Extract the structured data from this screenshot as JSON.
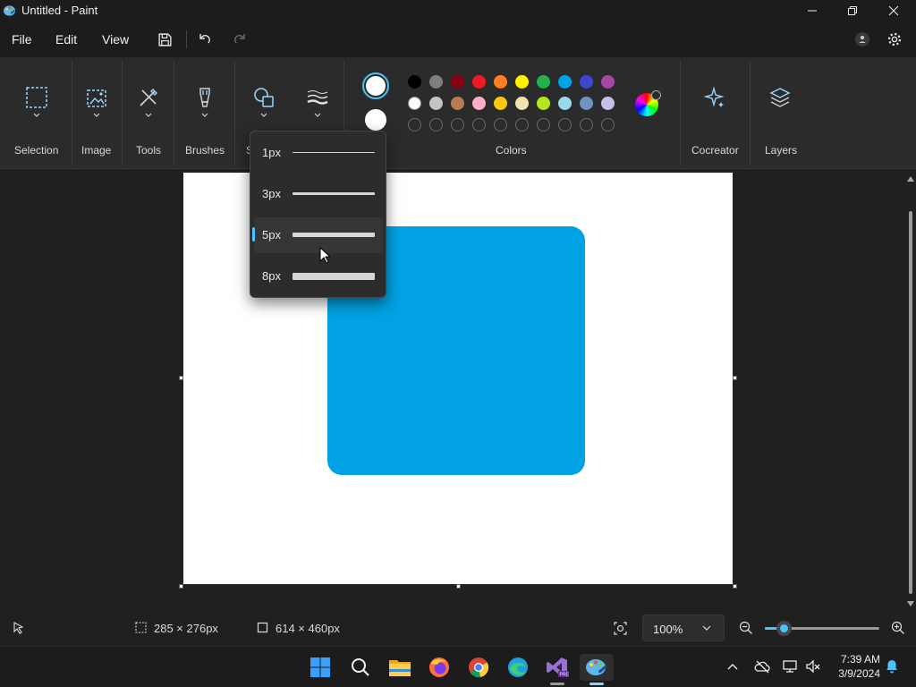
{
  "window": {
    "title": "Untitled - Paint",
    "icons": [
      "paint-app-icon",
      "minimize-icon",
      "restore-icon",
      "close-icon"
    ]
  },
  "menu": {
    "file": "File",
    "edit": "Edit",
    "view": "View",
    "icons": [
      "save-icon",
      "undo-icon",
      "redo-icon",
      "account-icon",
      "settings-icon"
    ]
  },
  "ribbon": {
    "selection": "Selection",
    "image": "Image",
    "tools": "Tools",
    "brushes": "Brushes",
    "shapes_partial": "S",
    "colors": "Colors",
    "cocreator": "Cocreator",
    "layers": "Layers"
  },
  "colors": {
    "primary": "#ffffff",
    "secondary": "#ffffff",
    "row1": [
      "#000000",
      "#7f7f7f",
      "#880015",
      "#ed1c24",
      "#ff7f27",
      "#fff200",
      "#22b14c",
      "#00a2e8",
      "#3f48cc",
      "#a349a4"
    ],
    "row2": [
      "#ffffff",
      "#c3c3c3",
      "#b97a57",
      "#ffaec9",
      "#ffc90e",
      "#efe4b0",
      "#b5e61d",
      "#99d9ea",
      "#7092be",
      "#c8bfe7"
    ],
    "accent": "#4cc2ff",
    "shape_fill": "#00a2e3"
  },
  "stroke_menu": {
    "items": [
      {
        "label": "1px",
        "thickness": 1,
        "selected": false
      },
      {
        "label": "3px",
        "thickness": 3,
        "selected": false
      },
      {
        "label": "5px",
        "thickness": 5,
        "selected": true
      },
      {
        "label": "8px",
        "thickness": 8,
        "selected": false
      }
    ]
  },
  "status": {
    "selection_size": "285 × 276px",
    "canvas_size": "614 × 460px",
    "zoom": "100%",
    "zoom_slider_fraction": 0.12
  },
  "taskbar": {
    "time": "7:39 AM",
    "date": "3/9/2024",
    "apps": [
      "start-icon",
      "search-icon",
      "file-explorer-icon",
      "firefox-icon",
      "chrome-icon",
      "edge-icon",
      "visual-studio-icon",
      "paint-icon"
    ]
  }
}
